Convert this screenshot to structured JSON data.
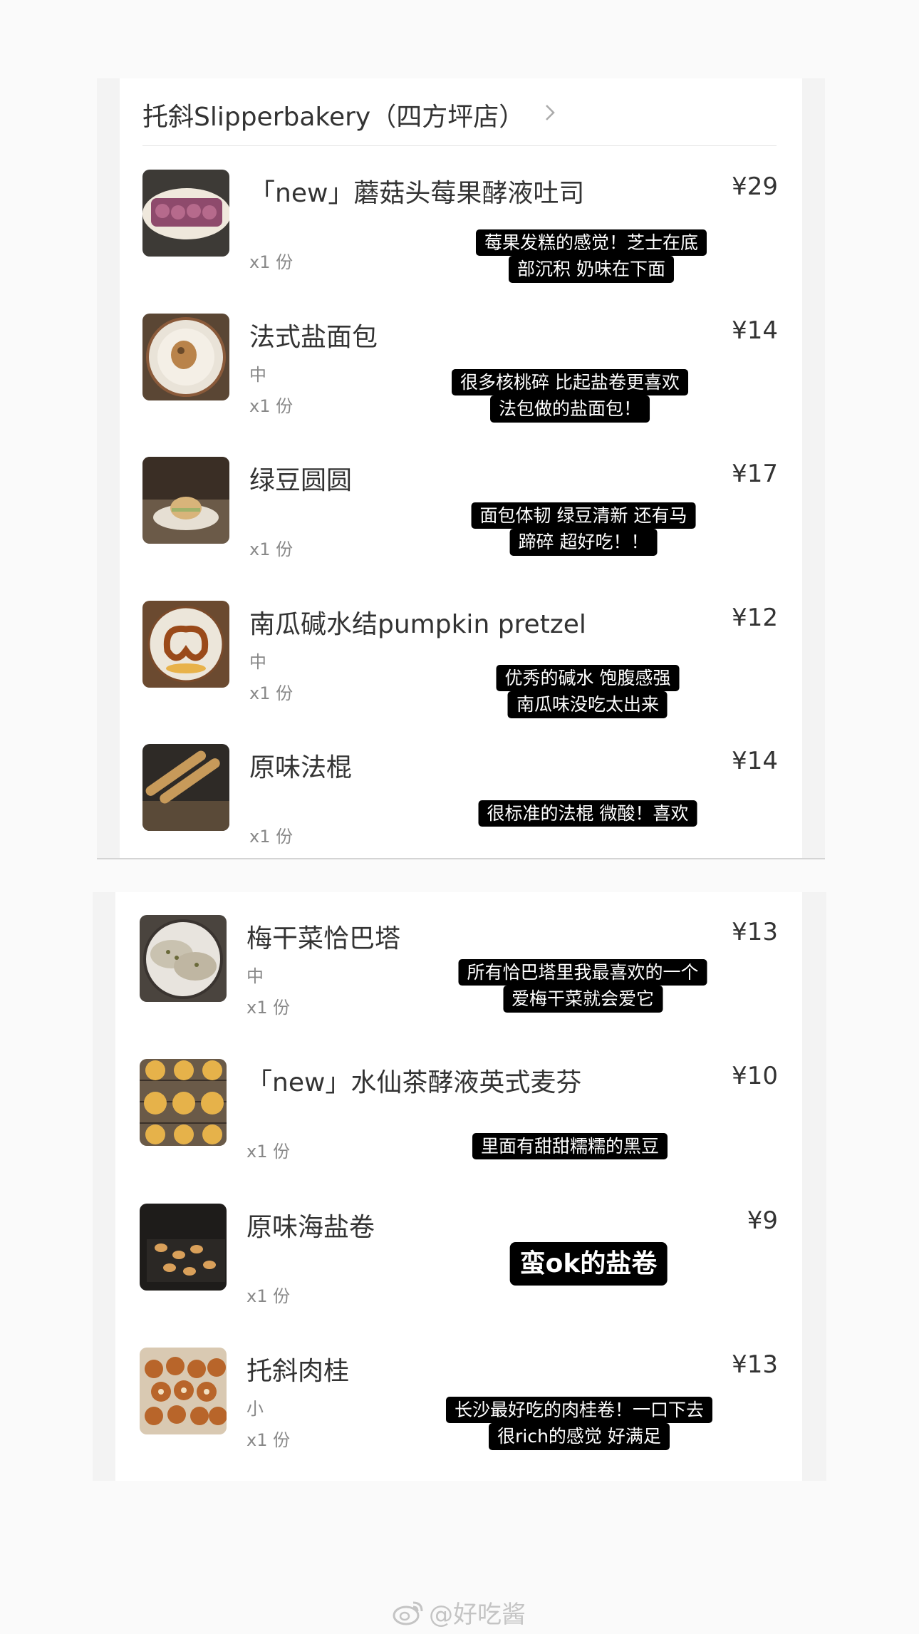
{
  "shop": {
    "name": "托斜Slipperbakery（四方坪店）",
    "chevron_icon": "chevron-right-icon"
  },
  "items": [
    {
      "name": "「new」蘑菇头莓果酵液吐司",
      "size": "",
      "qty": "x1 份",
      "price": "¥29",
      "note": [
        "莓果发糕的感觉！芝士在底",
        "部沉积 奶味在下面"
      ],
      "thumb": "berry-toast-image"
    },
    {
      "name": "法式盐面包",
      "size": "中",
      "qty": "x1 份",
      "price": "¥14",
      "note": [
        "很多核桃碎 比起盐卷更喜欢",
        "法包做的盐面包！"
      ],
      "thumb": "salt-bread-image"
    },
    {
      "name": "绿豆圆圆",
      "size": "",
      "qty": "x1 份",
      "price": "¥17",
      "note": [
        "面包体韧 绿豆清新 还有马",
        "蹄碎 超好吃！！"
      ],
      "thumb": "mung-bean-bun-image"
    },
    {
      "name": "南瓜碱水结pumpkin pretzel",
      "size": "中",
      "qty": "x1 份",
      "price": "¥12",
      "note": [
        "优秀的碱水 饱腹感强",
        "南瓜味没吃太出来"
      ],
      "thumb": "pumpkin-pretzel-image"
    },
    {
      "name": "原味法棍",
      "size": "",
      "qty": "x1 份",
      "price": "¥14",
      "note": [
        "很标准的法棍 微酸！喜欢"
      ],
      "thumb": "baguette-image"
    },
    {
      "name": "梅干菜恰巴塔",
      "size": "中",
      "qty": "x1 份",
      "price": "¥13",
      "note": [
        "所有恰巴塔里我最喜欢的一个",
        "爱梅干菜就会爱它"
      ],
      "thumb": "ciabatta-image"
    },
    {
      "name": "「new」水仙茶酵液英式麦芬",
      "size": "",
      "qty": "x1 份",
      "price": "¥10",
      "note": [
        "里面有甜甜糯糯的黑豆"
      ],
      "thumb": "english-muffin-image"
    },
    {
      "name": "原味海盐卷",
      "size": "",
      "qty": "x1 份",
      "price": "¥9",
      "note": [
        "蛮ok的盐卷"
      ],
      "thumb": "sea-salt-roll-image"
    },
    {
      "name": "托斜肉桂",
      "size": "小",
      "qty": "x1 份",
      "price": "¥13",
      "note": [
        "长沙最好吃的肉桂卷！一口下去",
        "很rich的感觉 好满足"
      ],
      "thumb": "cinnamon-roll-image"
    }
  ],
  "watermark": {
    "text": "@好吃酱",
    "icon": "weibo-icon"
  }
}
